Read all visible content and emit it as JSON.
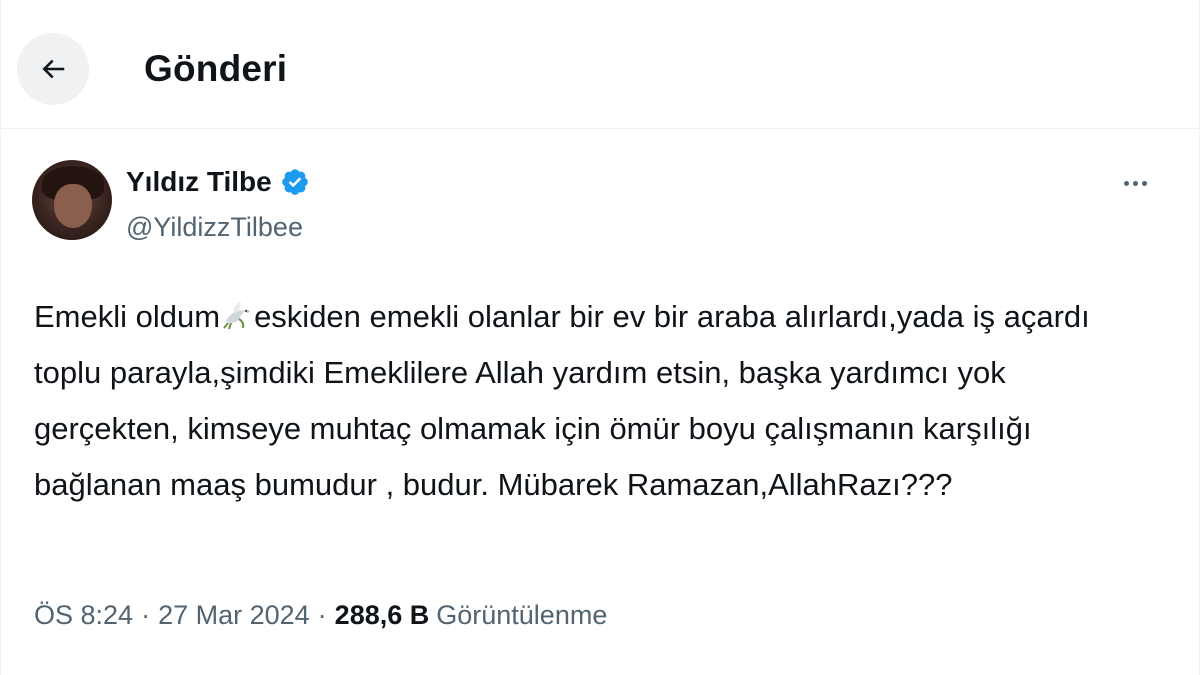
{
  "header": {
    "title": "Gönderi",
    "back_icon": "arrow-left-icon"
  },
  "author": {
    "display_name": "Yıldız Tilbe",
    "handle": "@YildizzTilbee",
    "verified": true,
    "verified_color": "#1d9bf0"
  },
  "tweet": {
    "text_before_emoji": "Emekli oldum",
    "emoji": "dove-icon",
    "text_after_emoji": "eskiden emekli olanlar bir ev bir araba alırlardı,yada iş açardı toplu parayla,şimdiki Emeklilere Allah yardım etsin, başka yardımcı yok gerçekten, kimseye muhtaç olmamak için ömür boyu çalışmanın karşılığı bağlanan maaş bumudur , budur. Mübarek Ramazan,AllahRazı???"
  },
  "meta": {
    "time": "ÖS 8:24",
    "separator": "·",
    "date": "27 Mar 2024",
    "views_count": "288,6 B",
    "views_label": "Görüntülenme"
  },
  "colors": {
    "text_primary": "#0f1419",
    "text_secondary": "#536471",
    "divider": "#eff3f4",
    "back_button_bg": "#eff1f2"
  }
}
